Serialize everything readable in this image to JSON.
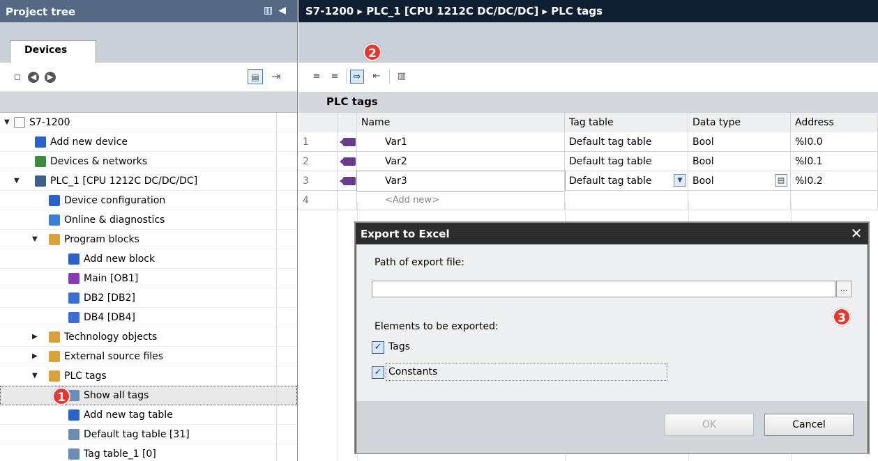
{
  "left_panel": {
    "title": "Project tree",
    "tab": "Devices",
    "tree": [
      {
        "label": "S7-1200",
        "indent": 0,
        "expander": "▼",
        "icon": "project-icon",
        "color": "#ffffff"
      },
      {
        "label": "Add new device",
        "indent": 1,
        "expander": "",
        "icon": "add-device-icon",
        "color": "#2a62c9"
      },
      {
        "label": "Devices & networks",
        "indent": 1,
        "expander": "",
        "icon": "network-icon",
        "color": "#3a8d3a"
      },
      {
        "label": "PLC_1 [CPU 1212C DC/DC/DC]",
        "indent": 1,
        "expander": "▼",
        "icon": "plc-icon",
        "color": "#3a5f8a"
      },
      {
        "label": "Device configuration",
        "indent": 2,
        "expander": "",
        "icon": "device-config-icon",
        "color": "#2a62c9"
      },
      {
        "label": "Online & diagnostics",
        "indent": 2,
        "expander": "",
        "icon": "diagnostics-icon",
        "color": "#3a7fd4"
      },
      {
        "label": "Program blocks",
        "indent": 2,
        "expander": "▼",
        "icon": "folder-icon",
        "color": "#d9a23a"
      },
      {
        "label": "Add new block",
        "indent": 3,
        "expander": "",
        "icon": "add-block-icon",
        "color": "#2a62c9"
      },
      {
        "label": "Main [OB1]",
        "indent": 3,
        "expander": "",
        "icon": "ob-icon",
        "color": "#8b3ab5"
      },
      {
        "label": "DB2 [DB2]",
        "indent": 3,
        "expander": "",
        "icon": "db-icon",
        "color": "#3a6ed4"
      },
      {
        "label": "DB4 [DB4]",
        "indent": 3,
        "expander": "",
        "icon": "db-icon",
        "color": "#3a6ed4"
      },
      {
        "label": "Technology objects",
        "indent": 2,
        "expander": "▶",
        "icon": "tech-folder-icon",
        "color": "#d9a23a"
      },
      {
        "label": "External source files",
        "indent": 2,
        "expander": "▶",
        "icon": "source-folder-icon",
        "color": "#d9a23a"
      },
      {
        "label": "PLC tags",
        "indent": 2,
        "expander": "▼",
        "icon": "tags-folder-icon",
        "color": "#d9a23a"
      },
      {
        "label": "Show all tags",
        "indent": 3,
        "expander": "",
        "icon": "show-tags-icon",
        "color": "#6a8db5"
      },
      {
        "label": "Add new tag table",
        "indent": 3,
        "expander": "",
        "icon": "add-table-icon",
        "color": "#2a62c9"
      },
      {
        "label": "Default tag table [31]",
        "indent": 3,
        "expander": "",
        "icon": "tag-table-icon",
        "color": "#6a8db5"
      },
      {
        "label": "Tag table_1 [0]",
        "indent": 3,
        "expander": "",
        "icon": "tag-table-icon",
        "color": "#6a8db5"
      }
    ]
  },
  "right_panel": {
    "breadcrumb": "S7-1200  ▸  PLC_1 [CPU 1212C DC/DC/DC]  ▸  PLC tags",
    "subtitle": "PLC tags",
    "columns": [
      "Name",
      "Tag table",
      "Data type",
      "Address"
    ],
    "rows": [
      {
        "num": "1",
        "name": "Var1",
        "table": "Default tag table",
        "type": "Bool",
        "address": "%I0.0"
      },
      {
        "num": "2",
        "name": "Var2",
        "table": "Default tag table",
        "type": "Bool",
        "address": "%I0.1"
      },
      {
        "num": "3",
        "name": "Var3",
        "table": "Default tag table",
        "type": "Bool",
        "address": "%I0.2"
      }
    ],
    "add_new_row": {
      "num": "4",
      "label": "<Add new>"
    }
  },
  "dialog": {
    "title": "Export to Excel",
    "path_label": "Path of export file:",
    "path_value": "",
    "browse_label": "...",
    "elements_label": "Elements to be exported:",
    "tags_label": "Tags",
    "tags_checked": true,
    "constants_label": "Constants",
    "constants_checked": true,
    "ok_label": "OK",
    "cancel_label": "Cancel"
  },
  "callouts": [
    "1",
    "2",
    "3"
  ],
  "colors": {
    "project_tree_title": "#546a84",
    "editor_title": "#0f1f33",
    "callout": "#e5382f",
    "tag_icon": "#6a3b8d"
  }
}
